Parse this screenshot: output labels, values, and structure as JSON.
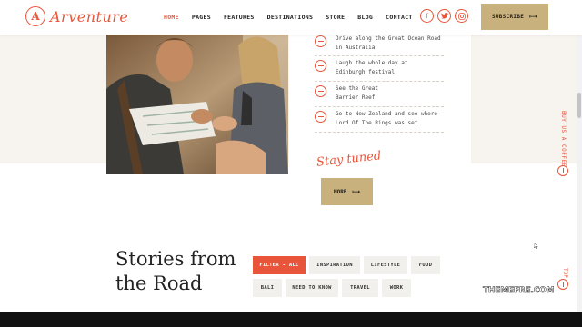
{
  "brand": {
    "logo_letter": "A",
    "name": "Arventure"
  },
  "nav": {
    "items": [
      {
        "label": "HOME",
        "active": true
      },
      {
        "label": "PAGES",
        "active": false
      },
      {
        "label": "FEATURES",
        "active": false
      },
      {
        "label": "DESTINATIONS",
        "active": false
      },
      {
        "label": "STORE",
        "active": false
      },
      {
        "label": "BLOG",
        "active": false
      },
      {
        "label": "CONTACT",
        "active": false
      }
    ]
  },
  "socials": {
    "facebook": "f",
    "twitter": "t",
    "instagram": "◎"
  },
  "subscribe": {
    "label": "SUBSCRIBE",
    "arrow": "⟼"
  },
  "bucket_list": {
    "items": [
      {
        "line1": "Drive along the Great Ocean Road",
        "line2": "in Australia"
      },
      {
        "line1": "Laugh the whole day at",
        "line2": "Edinburgh festival"
      },
      {
        "line1": "See the Great",
        "line2": "Barrier Reef"
      },
      {
        "line1": "Go to New Zealand and see where",
        "line2": "Lord Of The Rings was set"
      }
    ],
    "tagline": "Stay tuned",
    "more_label": "MORE",
    "more_arrow": "⟼"
  },
  "side": {
    "coffee_label": "BUY US A COFFEE",
    "top_label": "TOP"
  },
  "stories": {
    "title_line1": "Stories from",
    "title_line2": "the Road",
    "filters": [
      "FILTER - ALL",
      "INSPIRATION",
      "LIFESTYLE",
      "FOOD",
      "BALI",
      "NEED TO KNOW",
      "TRAVEL",
      "WORK"
    ]
  },
  "watermark": "THEMEFRE.COM",
  "colors": {
    "accent": "#e8553a",
    "gold": "#c9b17d",
    "beige": "#f7f3ee"
  }
}
